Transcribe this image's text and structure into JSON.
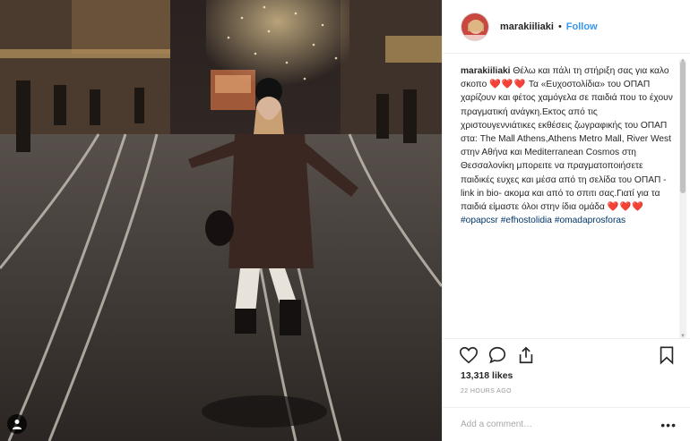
{
  "post": {
    "photo_alt": "Woman posing on tram tracks on a festive street at night",
    "user_tag_icon": "person-icon"
  },
  "header": {
    "username": "marakiiliaki",
    "separator": "•",
    "follow_label": "Follow"
  },
  "caption": {
    "username": "marakiiliaki",
    "part1": "Θέλω και πάλι τη στήριξη σας για καλο σκοπο",
    "hearts1": "❤️❤️❤️",
    "part2": "Τα «Ευχοστολίδια» του ΟΠΑΠ χαρίζουν και φέτος χαμόγελα σε παιδιά που το έχουν πραγματική ανάγκη.Εκτος από τις χριστουγεννιάτικες εκθέσεις ζωγραφικής του ΟΠΑΠ στα: The Mall Athens,Athens Metro Mall, River West στην Αθήνα και Mediterranean Cosmos στη Θεσσαλονίκη μπορειτε να πραγματοποιήσετε παιδικές ευχες και μέσα από τη σελίδα του ΟΠΑΠ -link in bio- ακομα και από το σπιτι σας.Γιατί για τα παιδιά είμαστε όλοι στην ίδια ομάδα",
    "hearts2": "❤️❤️❤️",
    "tag1": "#opapcsr",
    "tag2": "#efhostolidia",
    "tag3": "#omadaprosforas"
  },
  "actions": {
    "like_icon": "heart-icon",
    "comment_icon": "comment-icon",
    "share_icon": "share-icon",
    "save_icon": "bookmark-icon"
  },
  "likes": "13,318 likes",
  "timestamp": "22 HOURS AGO",
  "comment": {
    "placeholder": "Add a comment…",
    "more_label": "•••"
  },
  "colors": {
    "link_blue": "#3897f0",
    "hashtag": "#003569",
    "heart_red": "#e0245e",
    "border": "#efefef"
  }
}
